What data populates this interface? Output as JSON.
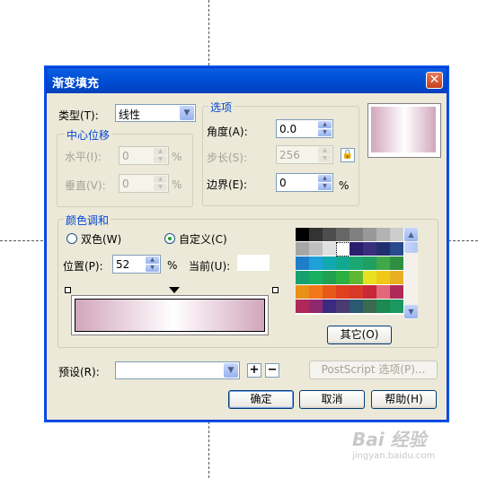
{
  "dialog": {
    "title": "渐变填充",
    "close_glyph": "✕"
  },
  "type": {
    "label": "类型(T):",
    "value": "线性"
  },
  "center_offset": {
    "title": "中心位移",
    "horizontal_label": "水平(I):",
    "horizontal_value": "0",
    "vertical_label": "垂直(V):",
    "vertical_value": "0",
    "unit": "%"
  },
  "options": {
    "title": "选项",
    "angle_label": "角度(A):",
    "angle_value": "0.0",
    "steps_label": "步长(S):",
    "steps_value": "256",
    "edge_label": "边界(E):",
    "edge_value": "0",
    "unit": "%"
  },
  "blend": {
    "title": "颜色调和",
    "two_color_label": "双色(W)",
    "custom_label": "自定义(C)",
    "custom_selected": true,
    "position_label": "位置(P):",
    "position_value": "52",
    "unit": "%",
    "current_label": "当前(U):",
    "other_button": "其它(O)",
    "palette_rows": [
      [
        "#000000",
        "#333333",
        "#4d4d4d",
        "#666666",
        "#808080",
        "#999999",
        "#b3b3b3",
        "#cccccc"
      ],
      [
        "#a6a6a6",
        "#c0c0c0",
        "#e0e0e0",
        "#ffffff",
        "#2a1e6e",
        "#3a2e7e",
        "#20306e",
        "#2a4a8e"
      ],
      [
        "#1e7fc8",
        "#1ea0d8",
        "#12a8b0",
        "#10a890",
        "#1aa870",
        "#20a060",
        "#40a848",
        "#2e9040"
      ],
      [
        "#16a070",
        "#18b060",
        "#20a050",
        "#2eb040",
        "#60b830",
        "#e8e020",
        "#f0c818",
        "#e8b020"
      ],
      [
        "#e89018",
        "#f07818",
        "#e85818",
        "#e04020",
        "#d83828",
        "#c82838",
        "#e06878",
        "#b02858"
      ],
      [
        "#b02858",
        "#902870",
        "#3a2a80",
        "#4a3a70",
        "#2a5a70",
        "#3a6a50",
        "#1a8a50",
        "#1a9860"
      ]
    ],
    "gradient_left": "#d1a6bc",
    "gradient_right": "#d1a6bc"
  },
  "preset": {
    "label": "预设(R):",
    "value": "",
    "add": "+",
    "remove": "−",
    "postscript_button": "PostScript 选项(P)..."
  },
  "buttons": {
    "ok": "确定",
    "cancel": "取消",
    "help": "帮助(H)"
  },
  "watermark": {
    "text": "Bai 经验",
    "url": "jingyan.baidu.com"
  }
}
